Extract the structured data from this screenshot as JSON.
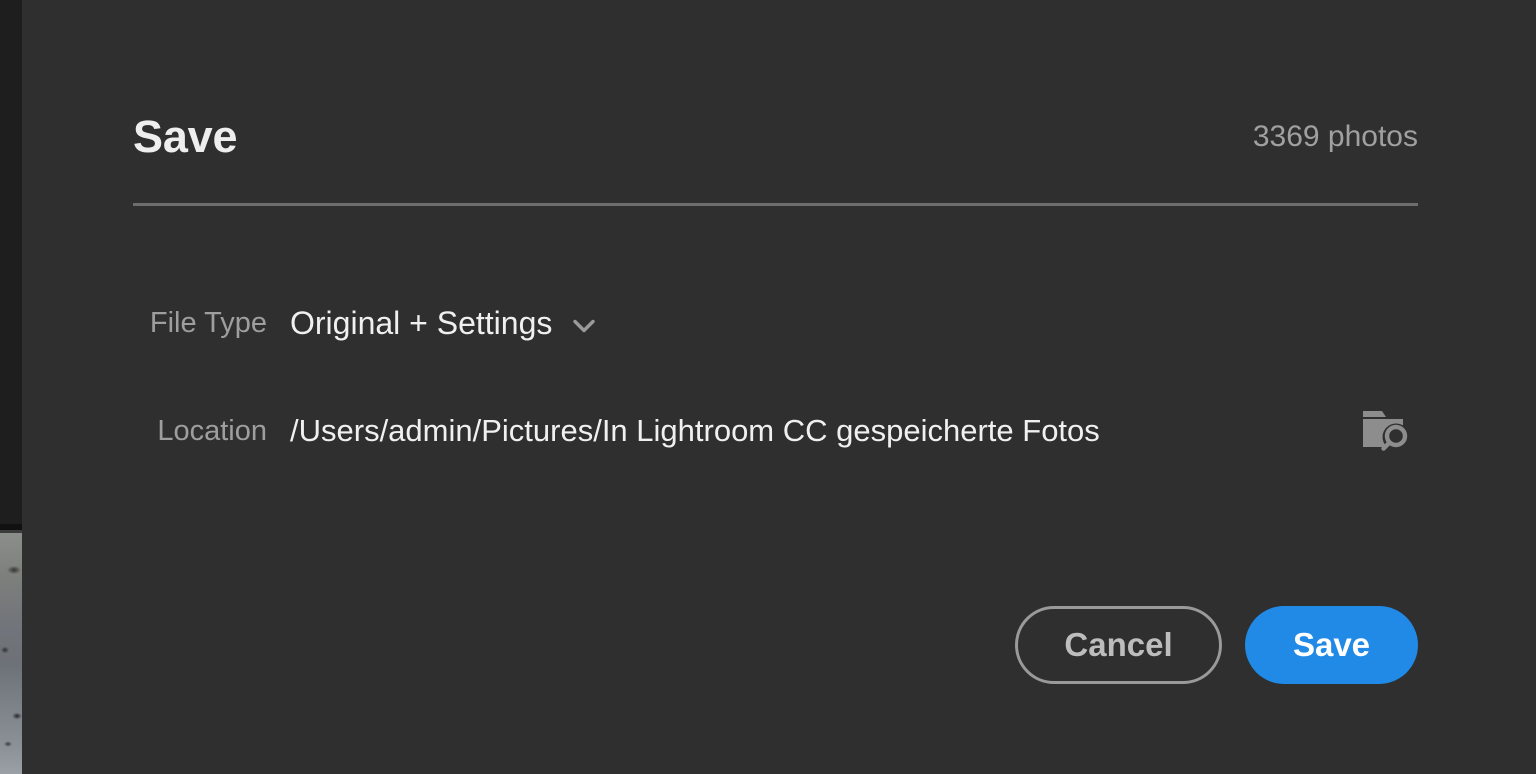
{
  "dialog": {
    "title": "Save",
    "photo_count": "3369 photos"
  },
  "fields": {
    "file_type": {
      "label": "File Type",
      "value": "Original + Settings",
      "dropdown_icon": "chevron-down-icon"
    },
    "location": {
      "label": "Location",
      "value": "/Users/admin/Pictures/In Lightroom CC gespeicherte Fotos",
      "browse_icon": "folder-search-icon"
    }
  },
  "footer": {
    "cancel_label": "Cancel",
    "save_label": "Save"
  },
  "colors": {
    "dialog_background": "#2f2f2f",
    "app_background": "#1e1e1e",
    "primary_button": "#2189e6",
    "divider": "#6d6d6d",
    "label_text": "#9e9e9e",
    "value_text": "#f0f0f0"
  }
}
